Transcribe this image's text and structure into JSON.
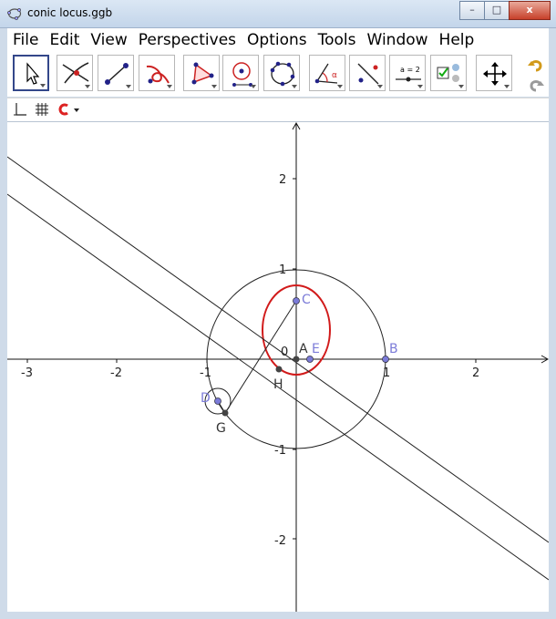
{
  "window": {
    "title": "conic locus.ggb",
    "controls": [
      "–",
      "□",
      "x"
    ]
  },
  "menu": [
    "File",
    "Edit",
    "View",
    "Perspectives",
    "Options",
    "Tools",
    "Window",
    "Help"
  ],
  "toolbar": {
    "tools": [
      "move-tool",
      "intersect-tool",
      "segment-tool",
      "locus-tool",
      "polygon-tool",
      "circle-tool",
      "conic-tool",
      "angle-tool",
      "reflect-tool",
      "slider-tool",
      "checkbox-tool",
      "move-graphics-tool"
    ],
    "selected": "move-tool",
    "undo": "undo-icon",
    "redo": "redo-icon"
  },
  "stylebar": [
    "axes-toggle-icon",
    "grid-toggle-icon",
    "point-capturing-icon"
  ],
  "graphics": {
    "x_ticks": [
      "-3",
      "-2",
      "-1",
      "0",
      "1",
      "2"
    ],
    "y_ticks": [
      "2",
      "1",
      "0",
      "-1",
      "-2"
    ],
    "origin_label": "0",
    "points": [
      {
        "name": "A",
        "x": 0,
        "y": 0,
        "color": "#444444"
      },
      {
        "name": "B",
        "x": 1,
        "y": 0,
        "color": "#7b7bd8"
      },
      {
        "name": "C",
        "x": 0,
        "y": 0.65,
        "color": "#7b7bd8"
      },
      {
        "name": "D",
        "x": -0.88,
        "y": -0.47,
        "color": "#7b7bd8"
      },
      {
        "name": "E",
        "x": 0.15,
        "y": 0,
        "color": "#7b7bd8"
      },
      {
        "name": "G",
        "x": -0.8,
        "y": -0.6,
        "color": "#444444"
      },
      {
        "name": "H",
        "x": -0.2,
        "y": -0.1,
        "color": "#444444"
      }
    ],
    "colors": {
      "locus": "#d11a1a",
      "blue_point": "#7b7bd8",
      "black": "#222222"
    }
  }
}
